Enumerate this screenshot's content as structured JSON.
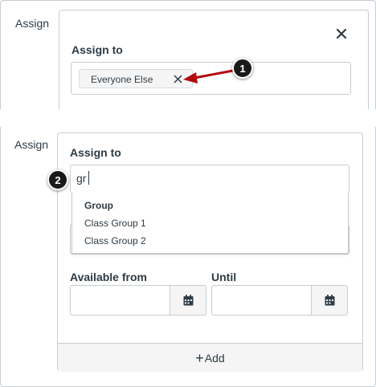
{
  "top_panel": {
    "side_label": "Assign",
    "assign_to_label": "Assign to",
    "chip_label": "Everyone Else",
    "callout_number": "1"
  },
  "bottom_panel": {
    "side_label": "Assign",
    "assign_to_label": "Assign to",
    "search_value": "gr",
    "callout_number": "2",
    "dropdown": {
      "group_heading": "Group",
      "options": [
        "Class Group 1",
        "Class Group 2"
      ]
    },
    "available_from_label": "Available from",
    "until_label": "Until",
    "add_label": "Add"
  },
  "colors": {
    "arrow": "#b20b0f",
    "callout_bg": "#1a1a1a",
    "text": "#2d3b45",
    "border": "#c7cdd1"
  },
  "icons": {
    "close": "close-icon",
    "chip_remove": "x-icon",
    "calendar": "calendar-icon",
    "add": "plus-icon"
  }
}
